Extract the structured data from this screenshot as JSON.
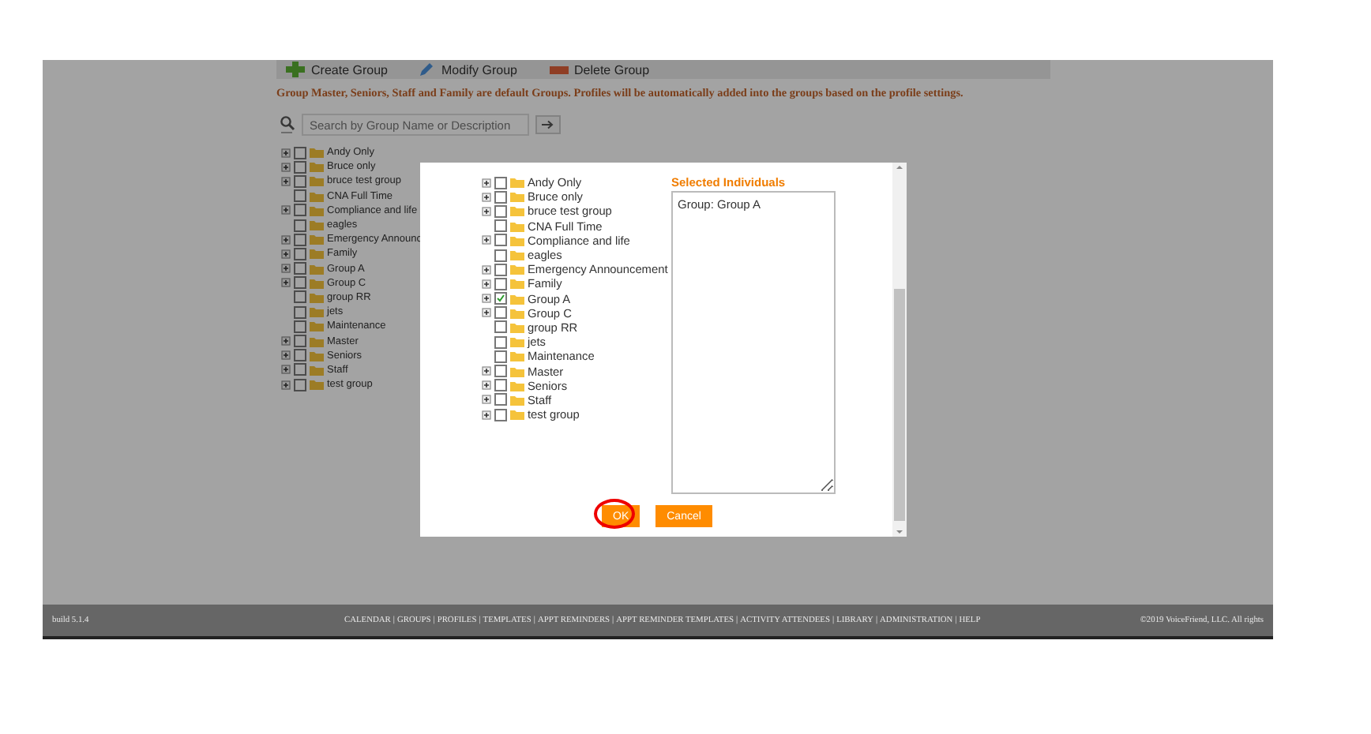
{
  "page": {
    "toolbar": [
      {
        "label": "Create Group",
        "kind": "create"
      },
      {
        "label": "Modify Group",
        "kind": "modify"
      },
      {
        "label": "Delete Group",
        "kind": "delete"
      }
    ],
    "notice": "Group Master, Seniors, Staff and Family are default Groups. Profiles will be automatically added into the groups based on the profile settings.",
    "search": {
      "placeholder": "Search by Group Name or Description"
    },
    "groups": [
      {
        "label": "Andy Only",
        "expandable": true,
        "checked": false
      },
      {
        "label": "Bruce only",
        "expandable": true,
        "checked": false
      },
      {
        "label": "bruce test group",
        "expandable": true,
        "checked": false
      },
      {
        "label": "CNA Full Time",
        "expandable": false,
        "checked": false
      },
      {
        "label": "Compliance and life",
        "expandable": true,
        "checked": false
      },
      {
        "label": "eagles",
        "expandable": false,
        "checked": false
      },
      {
        "label": "Emergency Announc",
        "expandable": true,
        "checked": false
      },
      {
        "label": "Family",
        "expandable": true,
        "checked": false
      },
      {
        "label": "Group A",
        "expandable": true,
        "checked": false
      },
      {
        "label": "Group C",
        "expandable": true,
        "checked": false
      },
      {
        "label": "group RR",
        "expandable": false,
        "checked": false
      },
      {
        "label": "jets",
        "expandable": false,
        "checked": false
      },
      {
        "label": "Maintenance",
        "expandable": false,
        "checked": false
      },
      {
        "label": "Master",
        "expandable": true,
        "checked": false
      },
      {
        "label": "Seniors",
        "expandable": true,
        "checked": false
      },
      {
        "label": "Staff",
        "expandable": true,
        "checked": false
      },
      {
        "label": "test group",
        "expandable": true,
        "checked": false
      }
    ]
  },
  "dialog": {
    "groups": [
      {
        "label": "Andy Only",
        "expandable": true,
        "checked": false
      },
      {
        "label": "Bruce only",
        "expandable": true,
        "checked": false
      },
      {
        "label": "bruce test group",
        "expandable": true,
        "checked": false
      },
      {
        "label": "CNA Full Time",
        "expandable": false,
        "checked": false
      },
      {
        "label": "Compliance and life",
        "expandable": true,
        "checked": false
      },
      {
        "label": "eagles",
        "expandable": false,
        "checked": false
      },
      {
        "label": "Emergency Announcement",
        "expandable": true,
        "checked": false
      },
      {
        "label": "Family",
        "expandable": true,
        "checked": false
      },
      {
        "label": "Group A",
        "expandable": true,
        "checked": true
      },
      {
        "label": "Group C",
        "expandable": true,
        "checked": false
      },
      {
        "label": "group RR",
        "expandable": false,
        "checked": false
      },
      {
        "label": "jets",
        "expandable": false,
        "checked": false
      },
      {
        "label": "Maintenance",
        "expandable": false,
        "checked": false
      },
      {
        "label": "Master",
        "expandable": true,
        "checked": false
      },
      {
        "label": "Seniors",
        "expandable": true,
        "checked": false
      },
      {
        "label": "Staff",
        "expandable": true,
        "checked": false
      },
      {
        "label": "test group",
        "expandable": true,
        "checked": false
      }
    ],
    "selected_title": "Selected Individuals",
    "selected_text": "Group: Group A",
    "buttons": [
      {
        "label": "OK",
        "highlighted": true
      },
      {
        "label": "Cancel",
        "highlighted": false
      }
    ]
  },
  "footer": {
    "build": "build 5.1.4",
    "links": [
      {
        "label": "CALENDAR",
        "separator": "|"
      },
      {
        "label": "GROUPS",
        "separator": "|"
      },
      {
        "label": "PROFILES",
        "separator": "|"
      },
      {
        "label": "TEMPLATES",
        "separator": "|"
      },
      {
        "label": "APPT REMINDERS",
        "separator": "|"
      },
      {
        "label": "APPT REMINDER TEMPLATES",
        "separator": "|"
      },
      {
        "label": "ACTIVITY ATTENDEES",
        "separator": "|"
      },
      {
        "label": "LIBRARY",
        "separator": "|"
      },
      {
        "label": "ADMINISTRATION",
        "separator": "|"
      },
      {
        "label": "HELP"
      }
    ],
    "copyright": "©2019 VoiceFriend, LLC. All rights"
  }
}
